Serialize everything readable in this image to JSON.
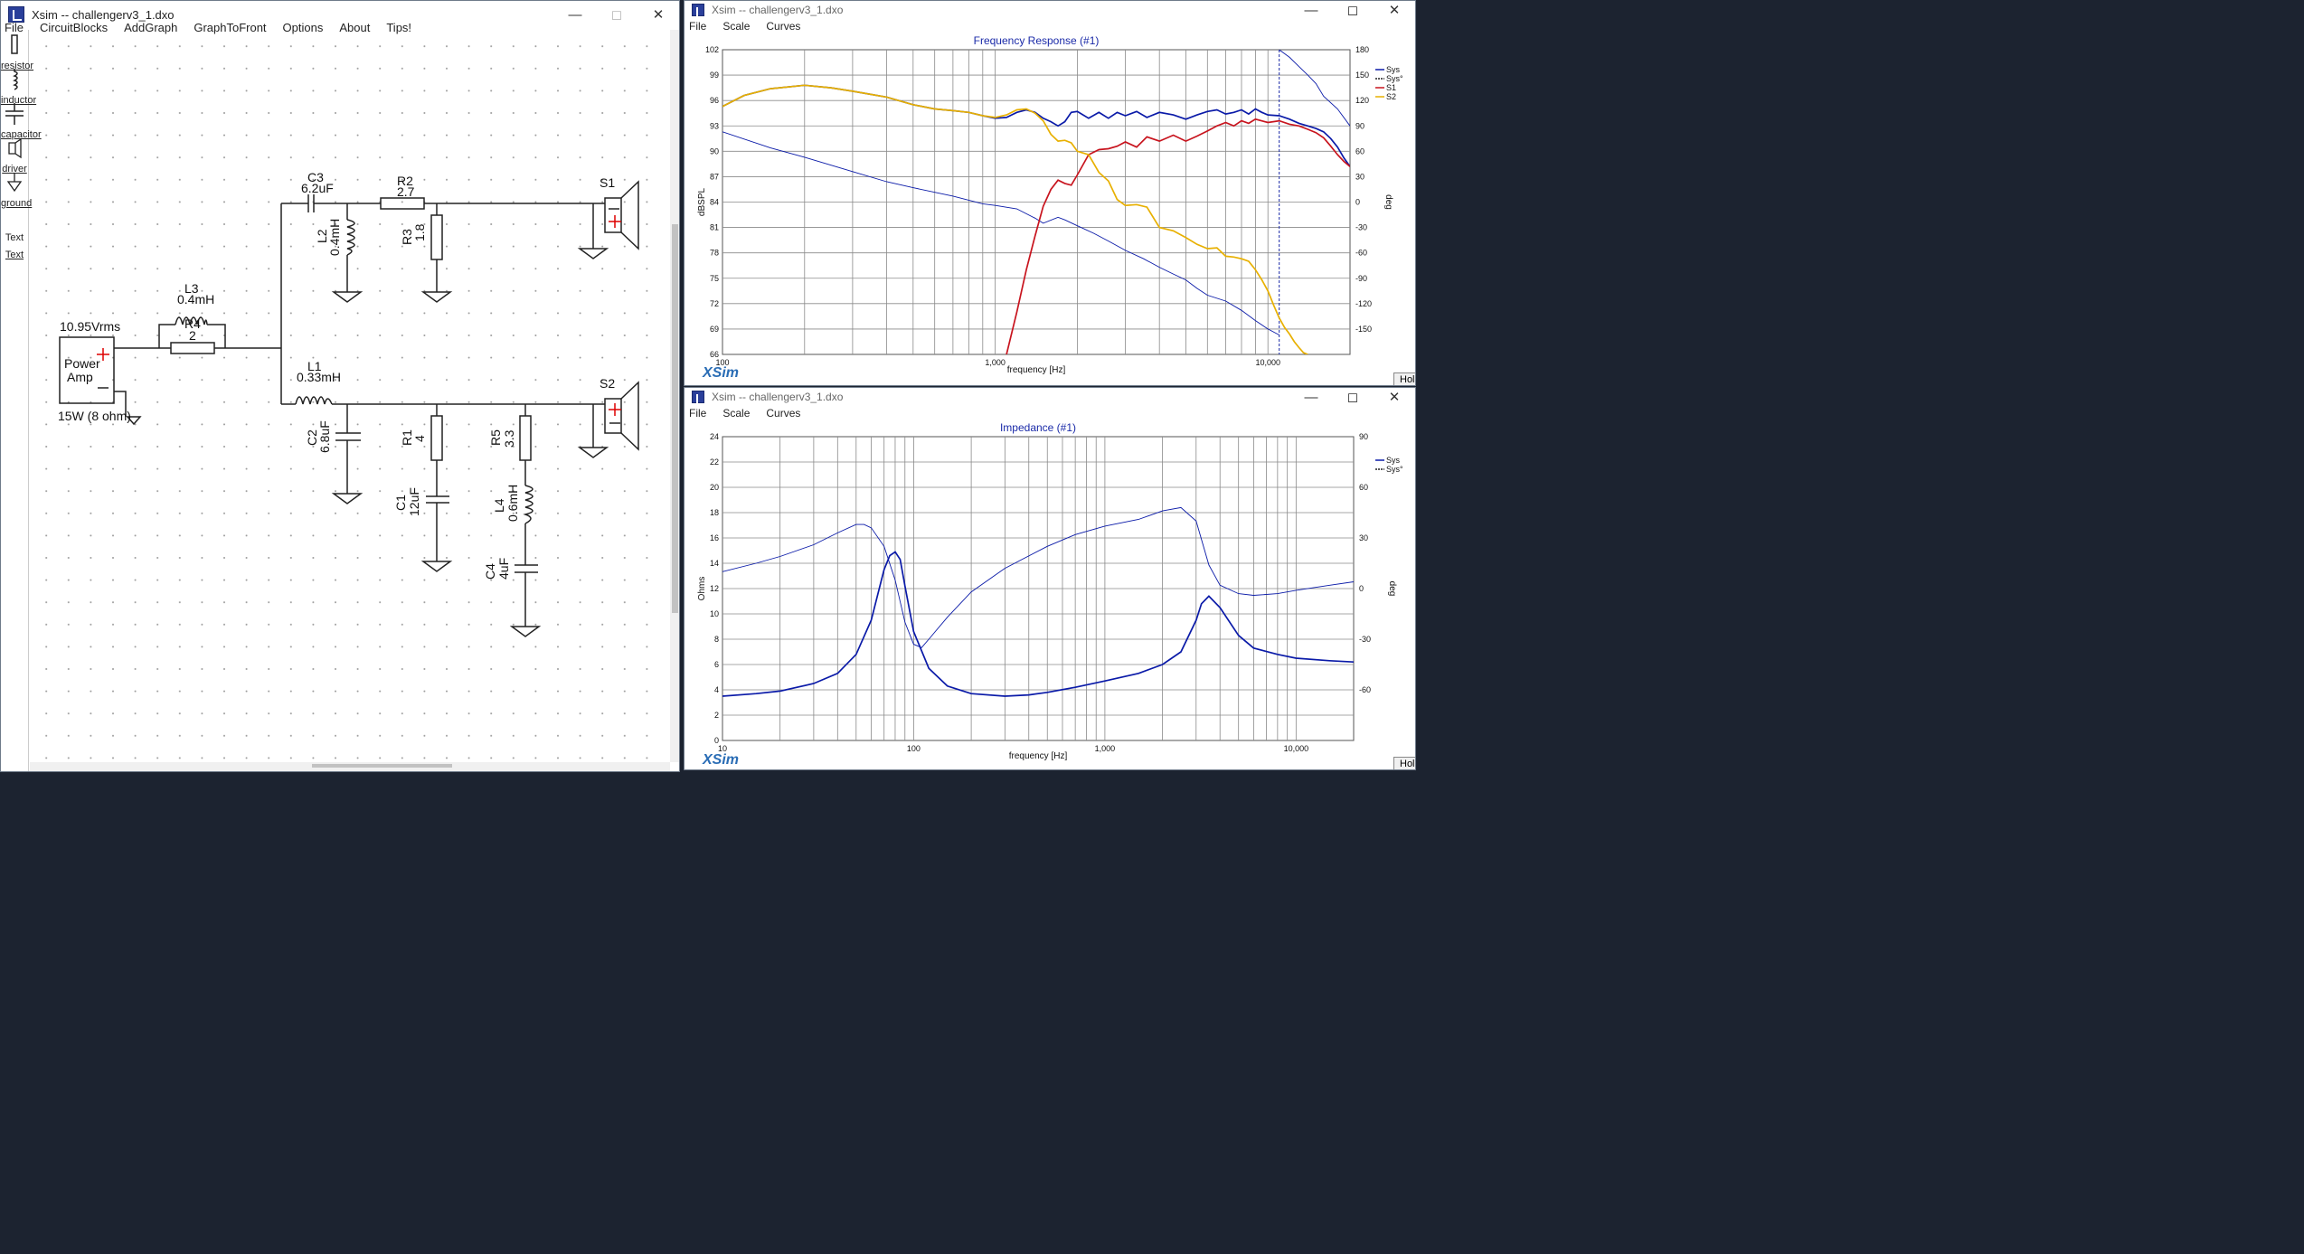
{
  "left_window": {
    "title": "Xsim -- challengerv3_1.dxo",
    "menu": [
      "File",
      "CircuitBlocks",
      "AddGraph",
      "GraphToFront",
      "Options",
      "About",
      "Tips!"
    ],
    "toolbar": [
      {
        "label": "resistor",
        "icon": "resistor-icon"
      },
      {
        "label": "inductor",
        "icon": "inductor-icon"
      },
      {
        "label": "capacitor",
        "icon": "capacitor-icon"
      },
      {
        "label": "driver",
        "icon": "driver-icon"
      },
      {
        "label": "ground",
        "icon": "ground-icon"
      },
      {
        "label": "Text",
        "icon": ""
      },
      {
        "label": "Text",
        "icon": ""
      }
    ]
  },
  "circuit": {
    "amp_voltage": "10.95Vrms",
    "amp_line1": "Power",
    "amp_line2": "Amp",
    "amp_power": "15W (8 ohm)",
    "c3_name": "C3",
    "c3_value": "6.2uF",
    "r2_name": "R2",
    "r2_value": "2.7",
    "l2_name": "L2",
    "l2_value": "0.4mH",
    "r3_name": "R3",
    "r3_value": "1.8",
    "l3_name": "L3",
    "l3_value": "0.4mH",
    "r4_name": "R4",
    "r4_value": "2",
    "l1_name": "L1",
    "l1_value": "0.33mH",
    "c2_name": "C2",
    "c2_value": "6.8uF",
    "r1_name": "R1",
    "r1_value": "4",
    "c1_name": "C1",
    "c1_value": "12uF",
    "r5_name": "R5",
    "r5_value": "3.3",
    "l4_name": "L4",
    "l4_value": "0.6mH",
    "c4_name": "C4",
    "c4_value": "4uF",
    "s1_name": "S1",
    "s2_name": "S2"
  },
  "freq_window": {
    "title": "Xsim -- challengerv3_1.dxo",
    "menu": [
      "File",
      "Scale",
      "Curves"
    ],
    "logo": "XSim",
    "hold": "Hold"
  },
  "imp_window": {
    "title": "Xsim -- challengerv3_1.dxo",
    "menu": [
      "File",
      "Scale",
      "Curves"
    ],
    "logo": "XSim",
    "hold": "Hold"
  },
  "chart_data": [
    {
      "type": "line",
      "title": "Frequency Response (#1)",
      "xlabel": "frequency [Hz]",
      "ylabel": "dBSPL",
      "y2label": "deg",
      "xscale": "log",
      "xlim": [
        100,
        20000
      ],
      "ylim": [
        66,
        102
      ],
      "y2lim": [
        -180,
        180
      ],
      "xticks": [
        "100",
        "1,000",
        "10,000"
      ],
      "yticks": [
        "102",
        "99",
        "96",
        "93",
        "90",
        "87",
        "84",
        "81",
        "78",
        "75",
        "72",
        "69",
        "66"
      ],
      "y2ticks": [
        "180",
        "150",
        "120",
        "90",
        "60",
        "30",
        "0",
        "-30",
        "-60",
        "-90",
        "-120",
        "-150"
      ],
      "grid": true,
      "legend_position": "top-right",
      "marker_x": 11000,
      "series": [
        {
          "name": "Sys",
          "color": "#0a1aa8",
          "style": "solid",
          "axis": "left",
          "x": [
            100,
            120,
            150,
            200,
            250,
            300,
            400,
            500,
            600,
            700,
            800,
            900,
            1000,
            1100,
            1200,
            1300,
            1400,
            1500,
            1600,
            1700,
            1800,
            1900,
            2000,
            2200,
            2400,
            2600,
            2800,
            3000,
            3300,
            3600,
            4000,
            4500,
            5000,
            5500,
            6000,
            6500,
            7000,
            7500,
            8000,
            8500,
            9000,
            9500,
            10000,
            11000,
            12000,
            13000,
            14000,
            15000,
            16000,
            17000,
            18000,
            19000,
            20000
          ],
          "y": [
            95.3,
            96.6,
            97.4,
            97.8,
            97.5,
            97.1,
            96.4,
            95.5,
            95.0,
            94.8,
            94.6,
            94.2,
            93.9,
            94.0,
            94.6,
            94.9,
            94.6,
            93.9,
            93.5,
            93.0,
            93.5,
            94.6,
            94.7,
            93.9,
            94.6,
            93.9,
            94.6,
            94.2,
            94.7,
            94.0,
            94.6,
            94.3,
            93.8,
            94.3,
            94.7,
            94.9,
            94.4,
            94.6,
            94.9,
            94.4,
            95.0,
            94.6,
            94.3,
            94.2,
            93.8,
            93.3,
            93.0,
            92.7,
            92.3,
            91.5,
            90.5,
            89.2,
            88.2
          ]
        },
        {
          "name": "Sys°",
          "color": "#0a1aa8",
          "style": "dashed",
          "axis": "right",
          "x": [
            100,
            150,
            200,
            300,
            400,
            500,
            700,
            900,
            1000,
            1200,
            1400,
            1500,
            1700,
            1800,
            2000,
            2300,
            2600,
            3000,
            3500,
            4000,
            4500,
            5000,
            5500,
            6000,
            7000,
            8000,
            9000,
            10000,
            11000,
            11000,
            12000,
            13000,
            14000,
            15000,
            16000,
            18000,
            20000
          ],
          "y": [
            83,
            64,
            53,
            36,
            24,
            17,
            7,
            -2,
            -4,
            -8,
            -19,
            -25,
            -18,
            -21,
            -28,
            -37,
            -46,
            -57,
            -67,
            -77,
            -85,
            -92,
            -102,
            -110,
            -117,
            -128,
            -140,
            -150,
            -157,
            180,
            171,
            160,
            150,
            140,
            125,
            110,
            90
          ]
        },
        {
          "name": "S1",
          "color": "#c8141e",
          "style": "solid",
          "axis": "left",
          "x": [
            1100,
            1200,
            1300,
            1400,
            1500,
            1600,
            1700,
            1800,
            1900,
            2000,
            2200,
            2400,
            2600,
            2800,
            3000,
            3300,
            3600,
            4000,
            4500,
            5000,
            5500,
            6000,
            6500,
            7000,
            7500,
            8000,
            8500,
            9000,
            10000,
            11000,
            12000,
            13000,
            14000,
            15000,
            16000,
            17000,
            18000,
            19000,
            20000
          ],
          "y": [
            66,
            71,
            76,
            80,
            83.5,
            85.5,
            86.6,
            86.2,
            86.0,
            87.2,
            89.6,
            90.2,
            90.3,
            90.6,
            91.1,
            90.5,
            91.7,
            91.2,
            91.9,
            91.2,
            91.8,
            92.4,
            93.0,
            93.4,
            93.0,
            93.6,
            93.3,
            93.8,
            93.4,
            93.6,
            93.2,
            93.0,
            92.6,
            92.2,
            91.6,
            90.6,
            89.6,
            88.8,
            88.2
          ]
        },
        {
          "name": "S2",
          "color": "#e8b000",
          "style": "solid",
          "axis": "left",
          "x": [
            100,
            120,
            150,
            200,
            250,
            300,
            400,
            500,
            600,
            700,
            800,
            900,
            1000,
            1100,
            1200,
            1300,
            1400,
            1500,
            1600,
            1700,
            1800,
            1900,
            2000,
            2200,
            2400,
            2600,
            2800,
            3000,
            3300,
            3600,
            4000,
            4500,
            5000,
            5500,
            6000,
            6500,
            7000,
            7500,
            8000,
            8500,
            9000,
            9500,
            10000,
            10500,
            11000,
            11500,
            12000,
            12500,
            13000,
            13500,
            14000
          ],
          "y": [
            95.3,
            96.6,
            97.4,
            97.8,
            97.5,
            97.1,
            96.4,
            95.5,
            95.0,
            94.8,
            94.6,
            94.2,
            94.0,
            94.3,
            94.9,
            95.0,
            94.5,
            93.6,
            92.0,
            91.2,
            91.3,
            91.0,
            90.0,
            89.6,
            87.5,
            86.5,
            84.3,
            83.6,
            83.7,
            83.4,
            81.0,
            80.6,
            79.8,
            79.0,
            78.5,
            78.6,
            77.6,
            77.5,
            77.3,
            77.0,
            76.0,
            74.8,
            73.5,
            71.8,
            70.3,
            69.2,
            68.4,
            67.5,
            66.8,
            66.2,
            66.0
          ]
        }
      ]
    },
    {
      "type": "line",
      "title": "Impedance (#1)",
      "xlabel": "frequency [Hz]",
      "ylabel": "Ohms",
      "y2label": "deg",
      "xscale": "log",
      "xlim": [
        10,
        20000
      ],
      "ylim": [
        0,
        24
      ],
      "y2lim": [
        -90,
        90
      ],
      "xticks": [
        "10",
        "100",
        "1,000",
        "10,000"
      ],
      "yticks": [
        "24",
        "22",
        "20",
        "18",
        "16",
        "14",
        "12",
        "10",
        "8",
        "6",
        "4",
        "2",
        "0"
      ],
      "y2ticks": [
        "90",
        "60",
        "30",
        "0",
        "-30",
        "-60"
      ],
      "grid": true,
      "legend_position": "top-right",
      "series": [
        {
          "name": "Sys",
          "color": "#0a1aa8",
          "style": "solid",
          "axis": "left",
          "x": [
            10,
            15,
            20,
            30,
            40,
            50,
            60,
            70,
            75,
            80,
            85,
            90,
            100,
            120,
            150,
            200,
            300,
            400,
            500,
            700,
            1000,
            1500,
            2000,
            2500,
            3000,
            3200,
            3500,
            4000,
            5000,
            6000,
            8000,
            10000,
            15000,
            20000
          ],
          "y": [
            3.5,
            3.7,
            3.9,
            4.5,
            5.3,
            6.8,
            9.5,
            13.5,
            14.6,
            14.9,
            14.3,
            12.2,
            8.6,
            5.7,
            4.3,
            3.7,
            3.5,
            3.6,
            3.8,
            4.2,
            4.7,
            5.3,
            6.0,
            7.0,
            9.5,
            10.8,
            11.4,
            10.5,
            8.3,
            7.3,
            6.8,
            6.5,
            6.3,
            6.2
          ]
        },
        {
          "name": "Sys°",
          "color": "#0a1aa8",
          "style": "dashed",
          "axis": "right",
          "x": [
            10,
            15,
            20,
            30,
            40,
            50,
            55,
            60,
            70,
            80,
            90,
            100,
            110,
            120,
            150,
            200,
            300,
            500,
            700,
            1000,
            1500,
            2000,
            2500,
            3000,
            3500,
            4000,
            5000,
            6000,
            8000,
            10000,
            15000,
            20000
          ],
          "y": [
            10,
            15,
            19,
            26,
            33,
            38,
            38,
            36,
            25,
            5,
            -20,
            -33,
            -35,
            -30,
            -17,
            -2,
            12,
            25,
            32,
            37,
            41,
            46,
            48,
            40,
            14,
            2,
            -3,
            -4,
            -3,
            -1,
            2,
            4
          ]
        }
      ]
    }
  ]
}
